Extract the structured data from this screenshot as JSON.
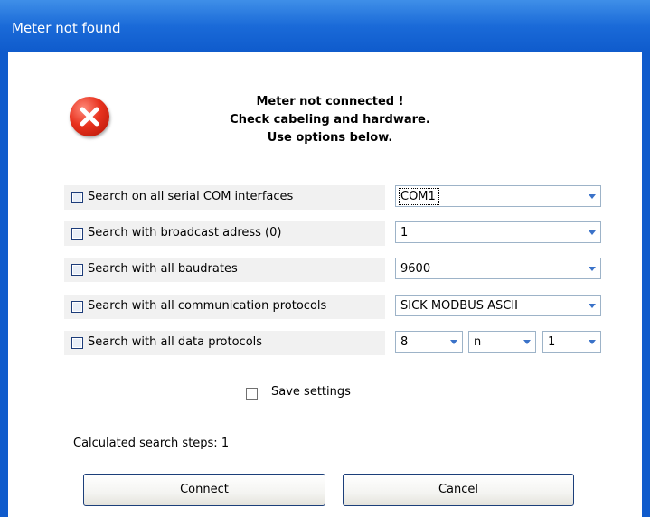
{
  "window": {
    "title": "Meter not found"
  },
  "message": {
    "line1": "Meter not connected !",
    "line2": "Check cabeling and hardware.",
    "line3": "Use options below."
  },
  "options": [
    {
      "label": "Search on all serial COM interfaces",
      "checked": false
    },
    {
      "label": "Search with broadcast adress (0)",
      "checked": false
    },
    {
      "label": "Search with all baudrates",
      "checked": false
    },
    {
      "label": "Search with all communication protocols",
      "checked": false
    },
    {
      "label": "Search with all data protocols",
      "checked": false
    }
  ],
  "combos": {
    "com_port": "COM1",
    "address": "1",
    "baudrate": "9600",
    "protocol": "SICK MODBUS ASCII",
    "data_bits": "8",
    "parity": "n",
    "stop_bits": "1"
  },
  "save_settings": {
    "label": "Save settings",
    "checked": false
  },
  "status": {
    "steps_text": "Calculated search steps: 1"
  },
  "buttons": {
    "connect": "Connect",
    "cancel": "Cancel"
  },
  "icons": {
    "error": "error-icon",
    "dropdown": "chevron-down-icon"
  },
  "colors": {
    "titlebar": "#0f5bcc",
    "error": "#e8321e",
    "row_bg": "#f1f1f1"
  }
}
